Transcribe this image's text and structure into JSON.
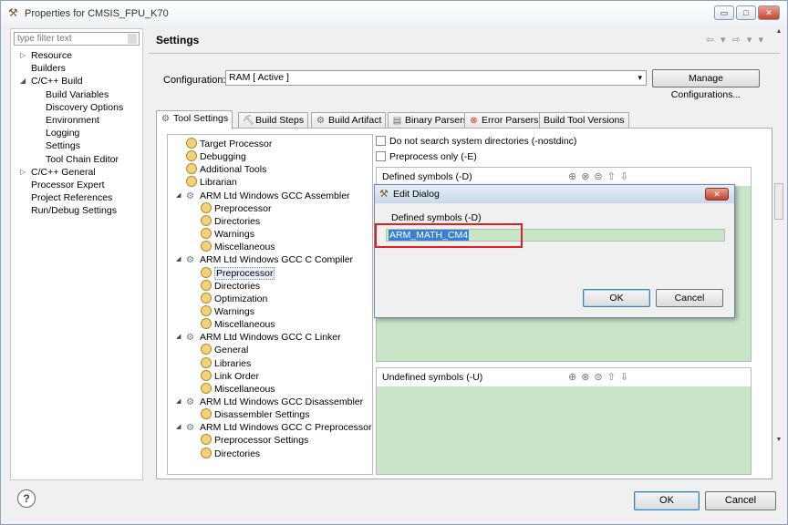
{
  "window": {
    "title": "Properties for CMSIS_FPU_K70",
    "min": "▭",
    "max": "□",
    "close": "✕"
  },
  "filter": {
    "placeholder": "type filter text"
  },
  "nav_tree": [
    {
      "label": "Resource",
      "depth": 0,
      "expander": "▷"
    },
    {
      "label": "Builders",
      "depth": 0,
      "expander": ""
    },
    {
      "label": "C/C++ Build",
      "depth": 0,
      "expander": "◢"
    },
    {
      "label": "Build Variables",
      "depth": 1,
      "expander": ""
    },
    {
      "label": "Discovery Options",
      "depth": 1,
      "expander": ""
    },
    {
      "label": "Environment",
      "depth": 1,
      "expander": ""
    },
    {
      "label": "Logging",
      "depth": 1,
      "expander": ""
    },
    {
      "label": "Settings",
      "depth": 1,
      "expander": ""
    },
    {
      "label": "Tool Chain Editor",
      "depth": 1,
      "expander": ""
    },
    {
      "label": "C/C++ General",
      "depth": 0,
      "expander": "▷"
    },
    {
      "label": "Processor Expert",
      "depth": 0,
      "expander": ""
    },
    {
      "label": "Project References",
      "depth": 0,
      "expander": ""
    },
    {
      "label": "Run/Debug Settings",
      "depth": 0,
      "expander": ""
    }
  ],
  "header": {
    "title": "Settings",
    "nav_back": "⇦ ▾",
    "nav_fwd": "⇨ ▾",
    "menu": "▾"
  },
  "config": {
    "label": "Configuration:",
    "value": "RAM  [ Active ]",
    "arrow": "▾",
    "manage_label": "Manage Configurations..."
  },
  "tabs": [
    {
      "label": "Tool Settings",
      "icon": "⚙"
    },
    {
      "label": "Build Steps",
      "icon": "⛏"
    },
    {
      "label": "Build Artifact",
      "icon": "⚙"
    },
    {
      "label": "Binary Parsers",
      "icon": "▤"
    },
    {
      "label": "Error Parsers",
      "icon": "⊗"
    },
    {
      "label": "Build Tool Versions",
      "icon": ""
    }
  ],
  "tool_tree": [
    {
      "label": "Target Processor",
      "depth": 0,
      "kind": "gear",
      "exp": ""
    },
    {
      "label": "Debugging",
      "depth": 0,
      "kind": "gear",
      "exp": ""
    },
    {
      "label": "Additional Tools",
      "depth": 0,
      "kind": "gear",
      "exp": ""
    },
    {
      "label": "Librarian",
      "depth": 0,
      "kind": "gear",
      "exp": ""
    },
    {
      "label": "ARM Ltd Windows GCC Assembler",
      "depth": 0,
      "kind": "tool",
      "exp": "◢"
    },
    {
      "label": "Preprocessor",
      "depth": 1,
      "kind": "gear",
      "exp": ""
    },
    {
      "label": "Directories",
      "depth": 1,
      "kind": "gear",
      "exp": ""
    },
    {
      "label": "Warnings",
      "depth": 1,
      "kind": "gear",
      "exp": ""
    },
    {
      "label": "Miscellaneous",
      "depth": 1,
      "kind": "gear",
      "exp": ""
    },
    {
      "label": "ARM Ltd Windows GCC C Compiler",
      "depth": 0,
      "kind": "tool",
      "exp": "◢"
    },
    {
      "label": "Preprocessor",
      "depth": 1,
      "kind": "gear",
      "exp": "",
      "selected": true
    },
    {
      "label": "Directories",
      "depth": 1,
      "kind": "gear",
      "exp": ""
    },
    {
      "label": "Optimization",
      "depth": 1,
      "kind": "gear",
      "exp": ""
    },
    {
      "label": "Warnings",
      "depth": 1,
      "kind": "gear",
      "exp": ""
    },
    {
      "label": "Miscellaneous",
      "depth": 1,
      "kind": "gear",
      "exp": ""
    },
    {
      "label": "ARM Ltd Windows GCC C Linker",
      "depth": 0,
      "kind": "tool",
      "exp": "◢"
    },
    {
      "label": "General",
      "depth": 1,
      "kind": "gear",
      "exp": ""
    },
    {
      "label": "Libraries",
      "depth": 1,
      "kind": "gear",
      "exp": ""
    },
    {
      "label": "Link Order",
      "depth": 1,
      "kind": "gear",
      "exp": ""
    },
    {
      "label": "Miscellaneous",
      "depth": 1,
      "kind": "gear",
      "exp": ""
    },
    {
      "label": "ARM Ltd Windows GCC Disassembler",
      "depth": 0,
      "kind": "tool",
      "exp": "◢"
    },
    {
      "label": "Disassembler Settings",
      "depth": 1,
      "kind": "gear",
      "exp": ""
    },
    {
      "label": "ARM Ltd Windows GCC C Preprocessor",
      "depth": 0,
      "kind": "tool",
      "exp": "◢"
    },
    {
      "label": "Preprocessor Settings",
      "depth": 1,
      "kind": "gear",
      "exp": ""
    },
    {
      "label": "Directories",
      "depth": 1,
      "kind": "gear",
      "exp": ""
    }
  ],
  "options": {
    "nostdinc": "Do not search system directories (-nostdinc)",
    "preprocess_only": "Preprocess only (-E)"
  },
  "defined": {
    "title": "Defined symbols (-D)",
    "icons": "⊕⊗⊜⇧⇩"
  },
  "undefined": {
    "title": "Undefined symbols (-U)",
    "icons": "⊕⊗⊜⇧⇩"
  },
  "dialog": {
    "title": "Edit Dialog",
    "field_label": "Defined symbols (-D)",
    "value": "ARM_MATH_CM4",
    "ok": "OK",
    "cancel": "Cancel",
    "close": "✕"
  },
  "bottom": {
    "help": "?",
    "ok": "OK",
    "cancel": "Cancel"
  },
  "colors": {
    "list_bg": "#c9e5c8",
    "selection": "#3a7fd4",
    "highlight_box": "#e02020"
  }
}
